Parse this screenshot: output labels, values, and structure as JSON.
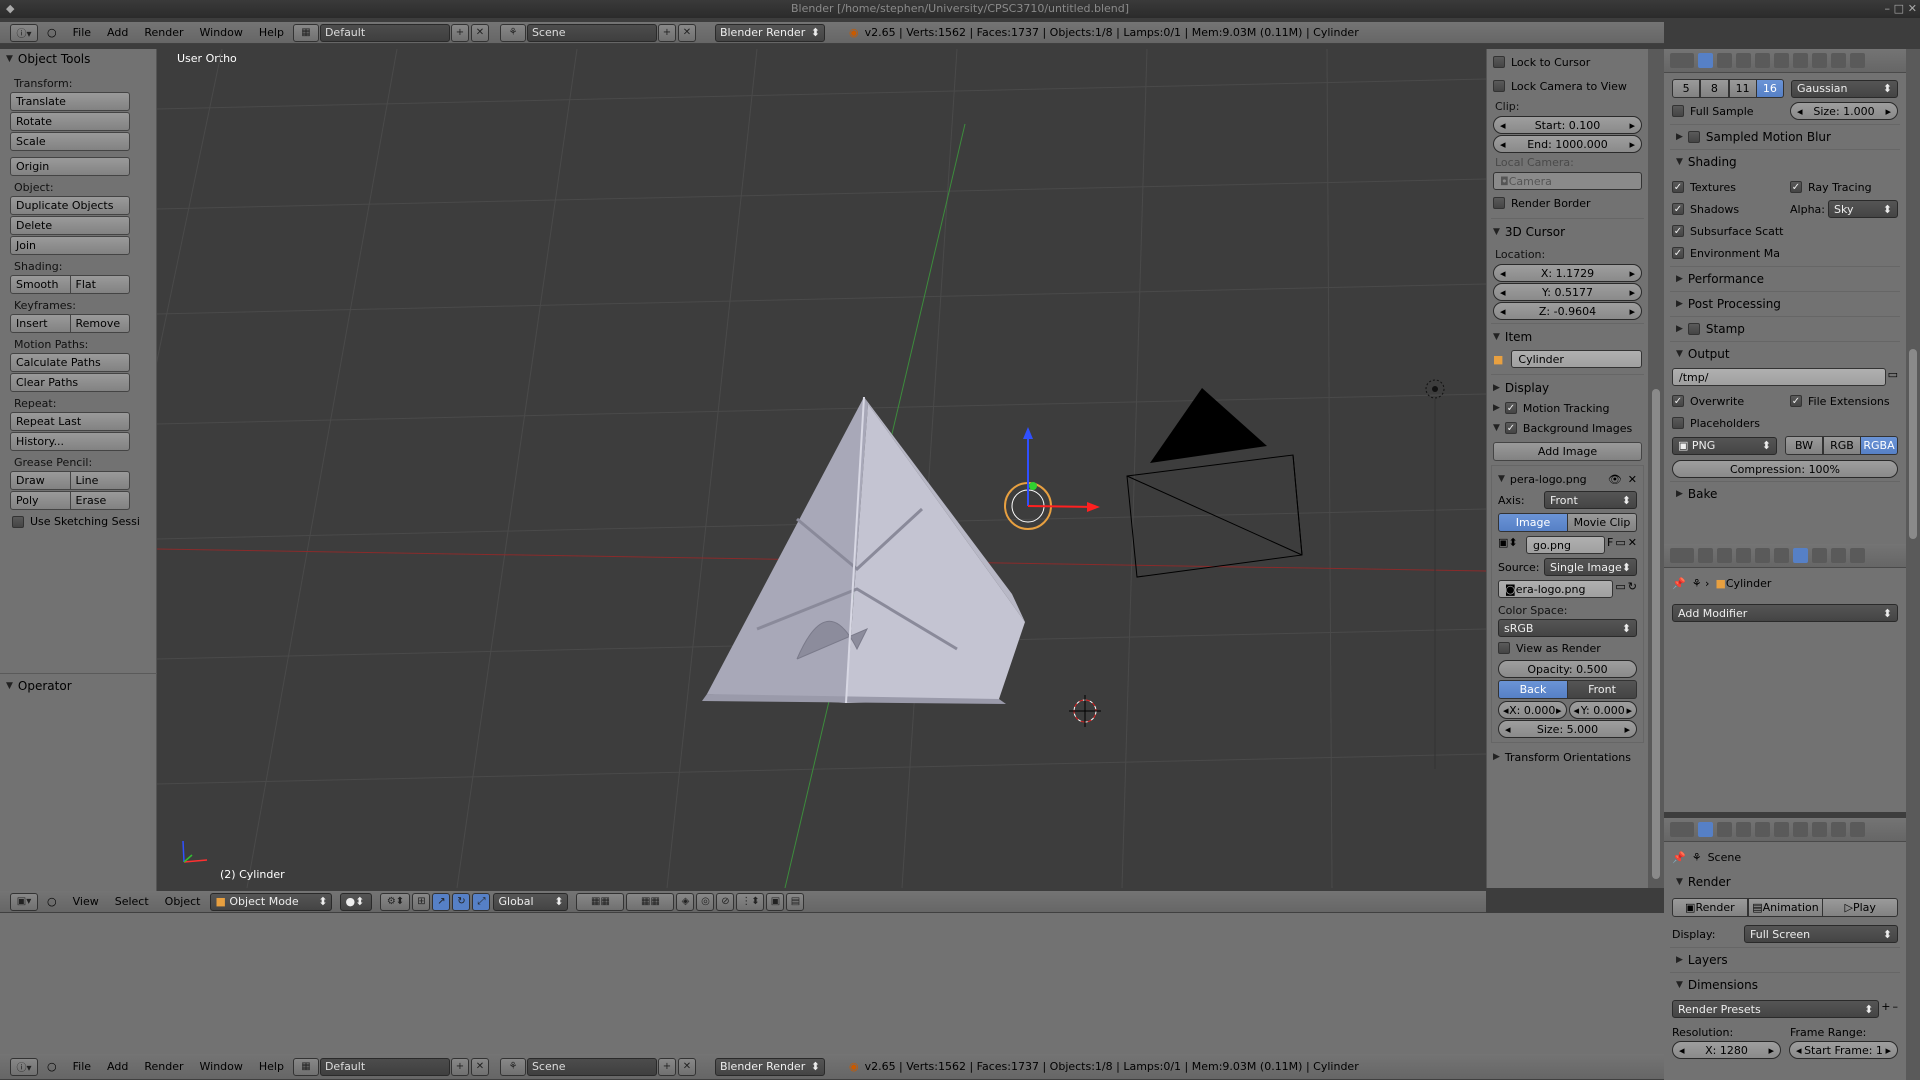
{
  "window": {
    "title": "Blender [/home/stephen/University/CPSC3710/untitled.blend]"
  },
  "info_bar": {
    "menus": [
      "File",
      "Add",
      "Render",
      "Window",
      "Help"
    ],
    "layout": "Default",
    "scene": "Scene",
    "engine": "Blender Render",
    "stats": "v2.65 | Verts:1562 | Faces:1737 | Objects:1/8 | Lamps:0/1 | Mem:9.03M (0.11M) | Cylinder"
  },
  "tool_shelf": {
    "title": "Object Tools",
    "transform_label": "Transform:",
    "translate": "Translate",
    "rotate": "Rotate",
    "scale": "Scale",
    "origin": "Origin",
    "object_label": "Object:",
    "duplicate": "Duplicate Objects",
    "delete": "Delete",
    "join": "Join",
    "shading_label": "Shading:",
    "smooth": "Smooth",
    "flat": "Flat",
    "keyframes_label": "Keyframes:",
    "insert": "Insert",
    "remove": "Remove",
    "motion_label": "Motion Paths:",
    "calc_paths": "Calculate Paths",
    "clear_paths": "Clear Paths",
    "repeat_label": "Repeat:",
    "repeat_last": "Repeat Last",
    "history": "History...",
    "grease_label": "Grease Pencil:",
    "draw": "Draw",
    "line": "Line",
    "poly": "Poly",
    "erase": "Erase",
    "sketching": "Use Sketching Sessi",
    "operator": "Operator"
  },
  "viewport": {
    "view_name": "User Ortho",
    "object_label": "(2) Cylinder",
    "menus": [
      "View",
      "Select",
      "Object"
    ],
    "mode": "Object Mode",
    "orientation": "Global"
  },
  "n_panel": {
    "lock_cursor": "Lock to Cursor",
    "lock_camera": "Lock Camera to View",
    "clip_label": "Clip:",
    "clip_start": "Start: 0.100",
    "clip_end": "End: 1000.000",
    "local_camera_label": "Local Camera:",
    "camera_field": "Camera",
    "render_border": "Render Border",
    "cursor_title": "3D Cursor",
    "location_label": "Location:",
    "cx": "X: 1.1729",
    "cy": "Y: 0.5177",
    "cz": "Z: -0.9604",
    "item_title": "Item",
    "item_name": "Cylinder",
    "display_title": "Display",
    "motion_tracking": "Motion Tracking",
    "bg_images": "Background Images",
    "add_image": "Add Image",
    "image_name": "pera-logo.png",
    "axis_label": "Axis:",
    "axis_value": "Front",
    "tab_image": "Image",
    "tab_movie": "Movie Clip",
    "img_short": "go.png",
    "img_f": "F",
    "source_label": "Source:",
    "source_value": "Single Image",
    "file_short": "era-logo.png",
    "color_space_label": "Color Space:",
    "color_space": "sRGB",
    "view_as_render": "View as Render",
    "opacity": "Opacity: 0.500",
    "back": "Back",
    "front": "Front",
    "ox": "X: 0.000",
    "oy": "Y: 0.000",
    "size": "Size: 5.000",
    "transform_orient": "Transform Orientations"
  },
  "render_props": {
    "samples": [
      "5",
      "8",
      "11",
      "16"
    ],
    "filter": "Gaussian",
    "full_sample": "Full Sample",
    "filter_size": "Size: 1.000",
    "sampled_mb": "Sampled Motion Blur",
    "shading": "Shading",
    "textures": "Textures",
    "ray_tracing": "Ray Tracing",
    "shadows": "Shadows",
    "alpha_label": "Alpha:",
    "alpha_value": "Sky",
    "sss": "Subsurface Scatt",
    "env": "Environment Ma",
    "performance": "Performance",
    "post": "Post Processing",
    "stamp": "Stamp",
    "output": "Output",
    "path": "/tmp/",
    "overwrite": "Overwrite",
    "file_ext": "File Extensions",
    "placeholders": "Placeholders",
    "format": "PNG",
    "bw": "BW",
    "rgb": "RGB",
    "rgba": "RGBA",
    "compression": "Compression: 100%",
    "bake": "Bake"
  },
  "modifier_props": {
    "object": "Cylinder",
    "add_modifier": "Add Modifier"
  },
  "scene_props": {
    "scene": "Scene",
    "render": "Render",
    "btn_render": "Render",
    "btn_anim": "Animation",
    "btn_play": "Play",
    "display_label": "Display:",
    "display_value": "Full Screen",
    "layers": "Layers",
    "dimensions": "Dimensions",
    "presets": "Render Presets",
    "resolution": "Resolution:",
    "frame_range": "Frame Range:",
    "res_x": "X: 1280",
    "start_frame": "Start Frame: 1"
  },
  "colors": {
    "accent": "#5680c6",
    "viewport_bg": "#3d3d3d",
    "panel": "#727272"
  }
}
